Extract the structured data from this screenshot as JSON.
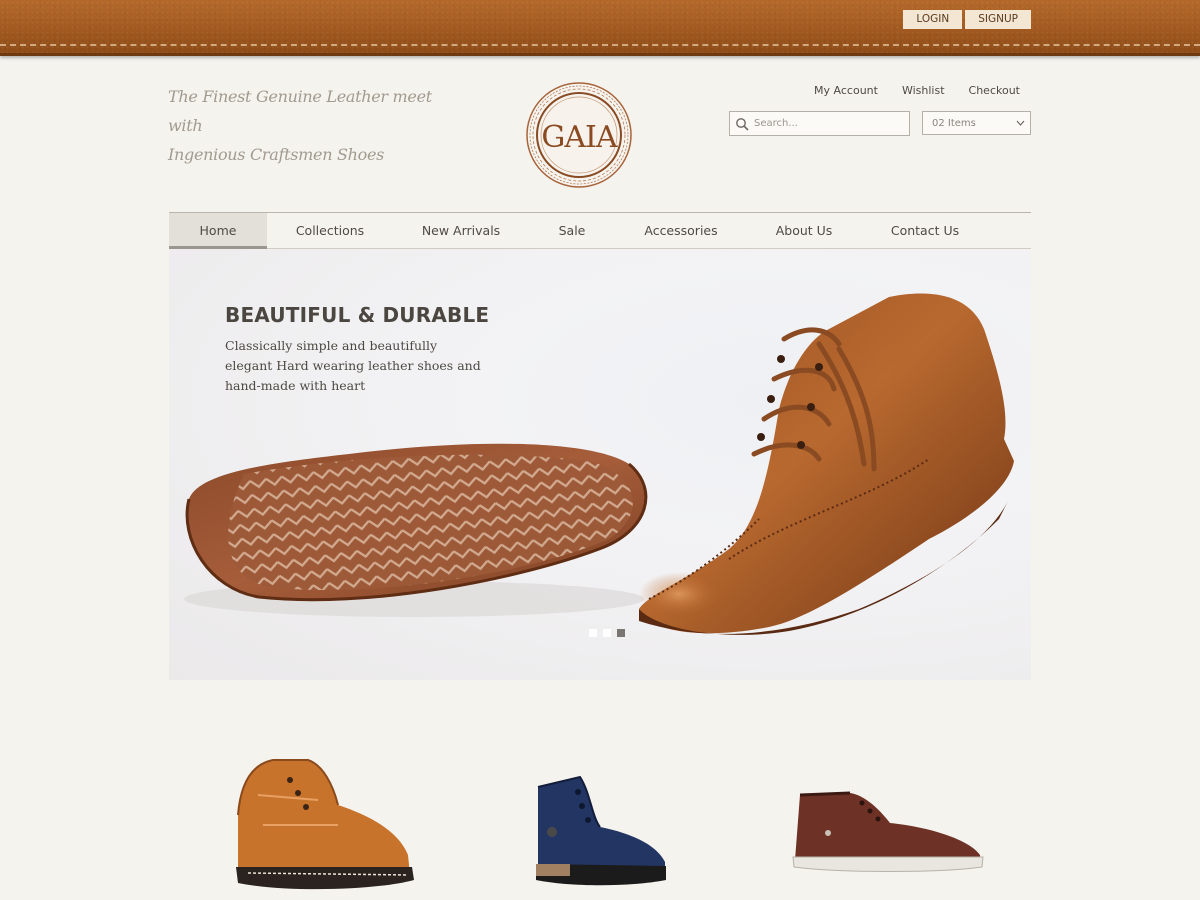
{
  "auth": {
    "login": "LOGIN",
    "signup": "SIGNUP"
  },
  "header": {
    "tagline_line1": "The Finest Genuine Leather meet with",
    "tagline_line2": "Ingenious Craftsmen Shoes",
    "logo_text": "GAIA"
  },
  "toplinks": {
    "account": "My Account",
    "wishlist": "Wishlist",
    "checkout": "Checkout"
  },
  "search": {
    "placeholder": "Search..."
  },
  "cart": {
    "selected": "02 Items"
  },
  "nav": [
    "Home",
    "Collections",
    "New Arrivals",
    "Sale",
    "Accessories",
    "About Us",
    "Contact Us"
  ],
  "hero": {
    "title": "BEAUTIFUL & DURABLE",
    "description": "Classically simple and beautifully elegant Hard wearing leather shoes and hand-made with heart",
    "slides": 3,
    "active_slide": 3
  },
  "colors": {
    "leather": "#a65d22",
    "background": "#f5f3ee",
    "logo": "#8a4a22"
  },
  "icons": {
    "search": "search-icon",
    "dropdown": "chevron-down-icon"
  }
}
